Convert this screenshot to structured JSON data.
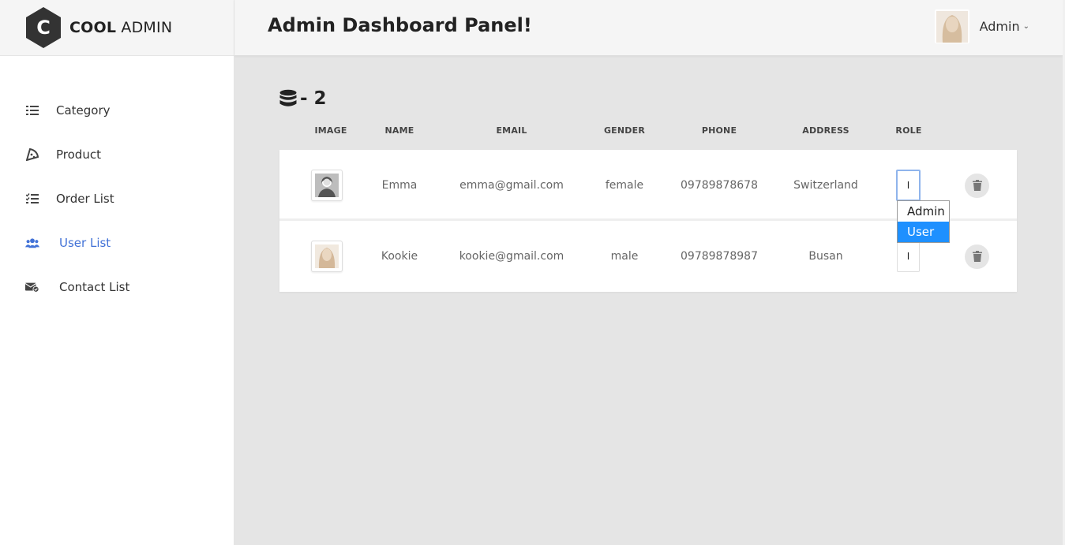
{
  "brand": {
    "logo_letter": "C",
    "name_bold": "COOL",
    "name_rest": "ADMIN"
  },
  "header": {
    "title": "Admin Dashboard Panel!",
    "account_name": "Admin"
  },
  "sidebar": {
    "items": [
      {
        "label": "Category",
        "icon": "list-icon",
        "active": false
      },
      {
        "label": "Product",
        "icon": "pizza-icon",
        "active": false
      },
      {
        "label": "Order List",
        "icon": "checklist-icon",
        "active": false
      },
      {
        "label": "User List",
        "icon": "users-icon",
        "active": true
      },
      {
        "label": "Contact List",
        "icon": "envelope-check-icon",
        "active": false
      }
    ]
  },
  "stat": {
    "icon": "database-icon",
    "text": "- 2"
  },
  "table": {
    "columns": [
      "IMAGE",
      "NAME",
      "EMAIL",
      "GENDER",
      "PHONE",
      "ADDRESS",
      "ROLE"
    ],
    "rows": [
      {
        "name": "Emma",
        "email": "emma@gmail.com",
        "gender": "female",
        "phone": "09789878678",
        "address": "Switzerland",
        "role_display": "I",
        "avatar": "default-avatar-icon"
      },
      {
        "name": "Kookie",
        "email": "kookie@gmail.com",
        "gender": "male",
        "phone": "09789878987",
        "address": "Busan",
        "role_display": "I",
        "avatar": "profile-photo"
      }
    ]
  },
  "role_dropdown": {
    "options": [
      "Admin",
      "User"
    ],
    "highlighted": "User"
  },
  "colors": {
    "accent": "#4272d7",
    "highlight": "#1e90ff",
    "background": "#e5e5e5"
  }
}
